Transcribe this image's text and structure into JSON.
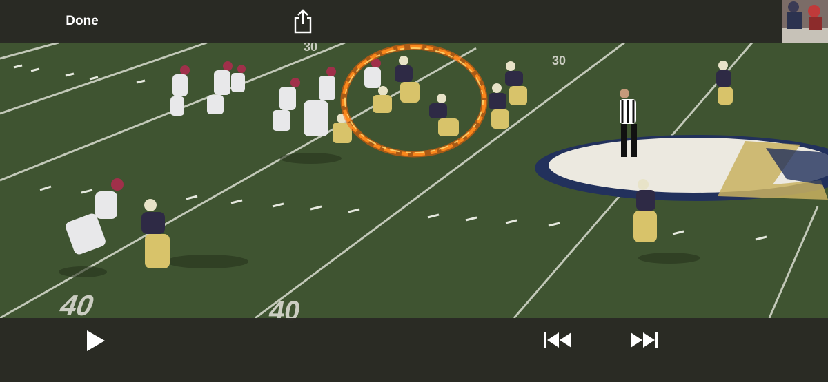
{
  "top_bar": {
    "done_label": "Done",
    "share_icon": "share-icon"
  },
  "controls": {
    "play_icon": "play-icon",
    "rewind_icon": "skip-back-icon",
    "forward_icon": "skip-forward-icon"
  },
  "video": {
    "yard_numbers": [
      "40",
      "40",
      "30",
      "30"
    ],
    "colors": {
      "field": "#3e5230",
      "home_jersey": "#2e2a45",
      "home_pants": "#d8c36a",
      "away_jersey": "#e8e8ea",
      "fire_ring": "#ff8a1c",
      "logo_fill": "#ece9e0",
      "logo_accent": "#c9b160"
    }
  }
}
